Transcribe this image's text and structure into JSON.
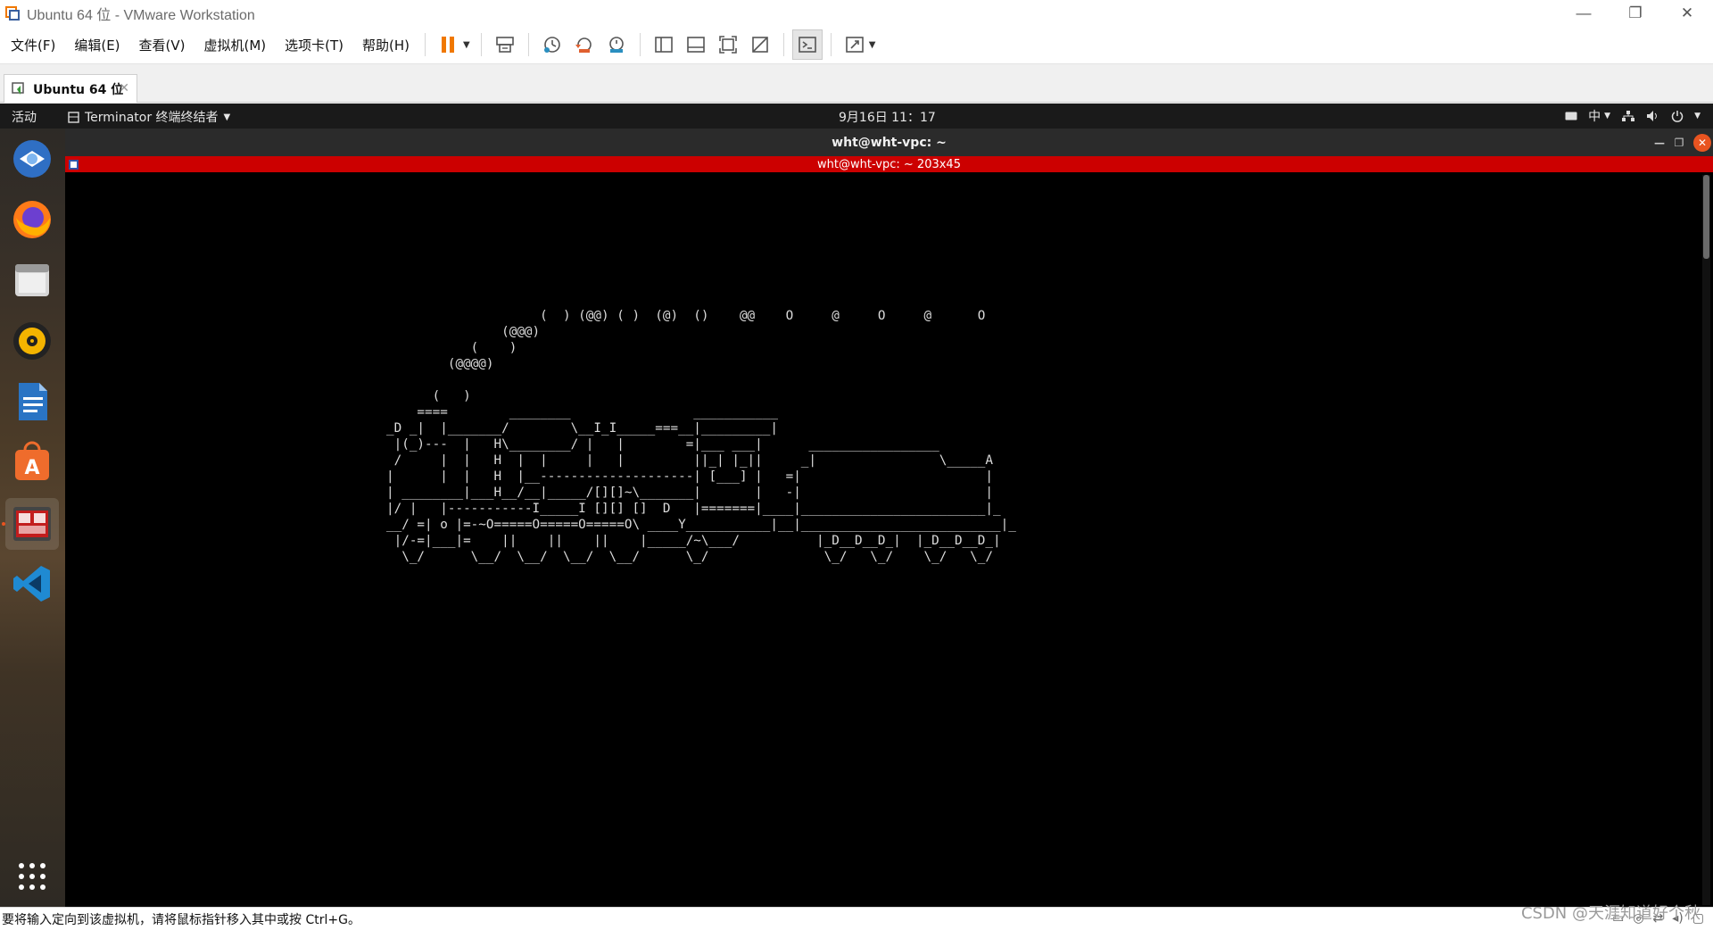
{
  "window": {
    "title": "Ubuntu 64 位 - VMware Workstation",
    "minimize": "—",
    "restore": "❐",
    "close": "✕"
  },
  "menu": {
    "file": "文件(F)",
    "edit": "编辑(E)",
    "view": "查看(V)",
    "vm": "虚拟机(M)",
    "tabs": "选项卡(T)",
    "help": "帮助(H)"
  },
  "toolbar": {
    "icons": [
      "pause-icon",
      "send-ctrl-alt-del-icon",
      "snapshot-take-icon",
      "snapshot-revert-icon",
      "snapshot-manager-icon",
      "view-library-icon",
      "view-thumbnail-icon",
      "view-fullscreen-icon",
      "view-unity-icon",
      "console-view-icon",
      "stretch-view-icon"
    ],
    "accent": "#f07800"
  },
  "vm_tab": {
    "label": "Ubuntu 64 位",
    "close": "✕"
  },
  "gnome": {
    "activities": "活动",
    "app_menu": "Terminator 终端终结者",
    "clock": "9月16日  11：17",
    "input_method": "中",
    "accent": "#e95420"
  },
  "dock": {
    "items": [
      "thunderbird-icon",
      "firefox-icon",
      "files-icon",
      "rhythmbox-icon",
      "libreoffice-writer-icon",
      "software-center-icon",
      "terminator-icon",
      "vscode-icon"
    ],
    "show_apps": "show-applications-icon"
  },
  "terminal": {
    "window_title": "wht@wht-vpc: ~",
    "group_bar": "wht@wht-vpc: ~ 203x45",
    "bar_color": "#cc0000",
    "lines": [
      "                    (  ) (@@) ( )  (@)  ()    @@    O     @     O     @      O",
      "               (@@@)",
      "           (    )",
      "        (@@@@)",
      "",
      "      (   )",
      "    ====        ________                ___________",
      "_D _|  |_______/        \\__I_I_____===__|_________|",
      " |(_)---  |   H\\________/ |   |        =|___ ___|      _________________",
      " /     |  |   H  |  |     |   |         ||_| |_||     _|                \\_____A",
      "|      |  |   H  |__--------------------| [___] |   =|                        |",
      "| ________|___H__/__|_____/[][]~\\_______|       |   -|                        |",
      "|/ |   |-----------I_____I [][] []  D   |=======|____|________________________|_",
      "__/ =| o |=-~O=====O=====O=====O\\ ____Y___________|__|__________________________|_",
      " |/-=|___|=    ||    ||    ||    |_____/~\\___/          |_D__D__D_|  |_D__D__D_|",
      "  \\_/      \\__/  \\__/  \\__/  \\__/      \\_/               \\_/   \\_/    \\_/   \\_/"
    ]
  },
  "statusbar": {
    "message": "要将输入定向到该虚拟机，请将鼠标指针移入其中或按 Ctrl+G。",
    "watermark": "CSDN @天涯知道好个秋"
  }
}
